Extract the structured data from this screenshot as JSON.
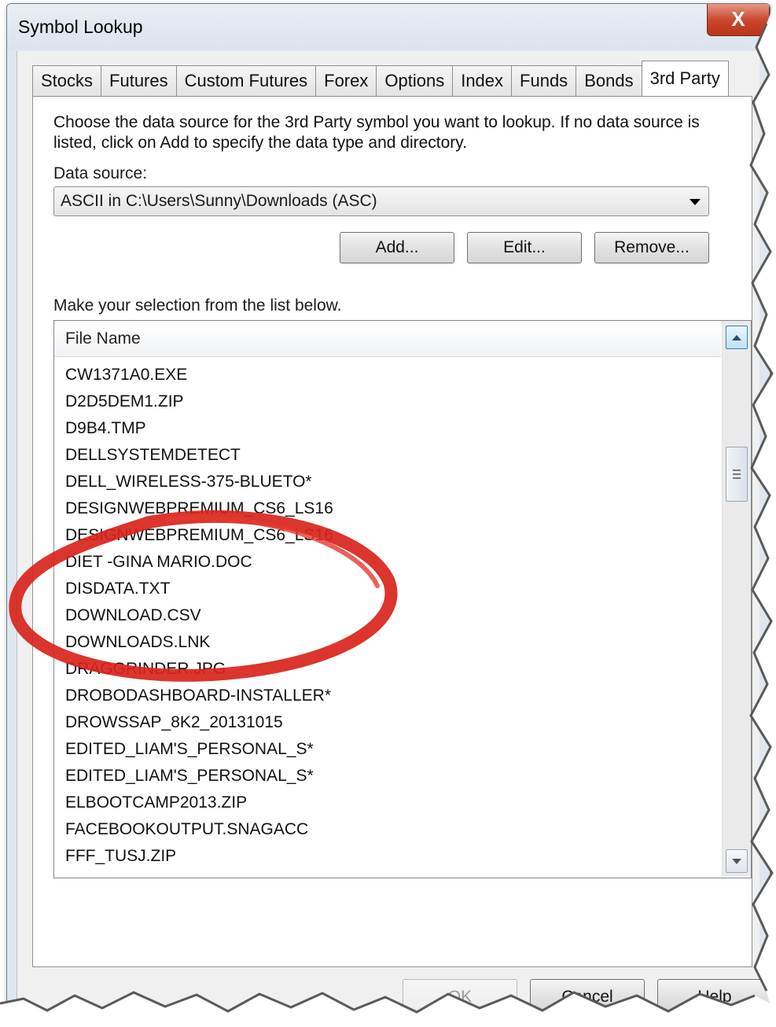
{
  "window": {
    "title": "Symbol Lookup",
    "close_glyph": "X"
  },
  "tabs": [
    {
      "label": "Stocks",
      "active": false
    },
    {
      "label": "Futures",
      "active": false
    },
    {
      "label": "Custom Futures",
      "active": false
    },
    {
      "label": "Forex",
      "active": false
    },
    {
      "label": "Options",
      "active": false
    },
    {
      "label": "Index",
      "active": false
    },
    {
      "label": "Funds",
      "active": false
    },
    {
      "label": "Bonds",
      "active": false
    },
    {
      "label": "3rd Party",
      "active": true
    }
  ],
  "panel": {
    "description": "Choose the data source for the 3rd Party symbol you want to lookup.  If no data source is listed, click on Add to specify the data type and directory.",
    "data_source_label": "Data source:",
    "data_source_value": "ASCII in C:\\Users\\Sunny\\Downloads (ASC)",
    "add_label": "Add...",
    "edit_label": "Edit...",
    "remove_label": "Remove...",
    "selection_label": "Make your selection from the list below."
  },
  "list": {
    "column_header": "File Name",
    "rows": [
      "CW1371A0.EXE",
      "D2D5DEM1.ZIP",
      "D9B4.TMP",
      "DELLSYSTEMDETECT",
      "DELL_WIRELESS-375-BLUETO*",
      "DESIGNWEBPREMIUM_CS6_LS16",
      "DESIGNWEBPREMIUM_CS6_LS16",
      "DIET -GINA MARIO.DOC",
      "DISDATA.TXT",
      "DOWNLOAD.CSV",
      "DOWNLOADS.LNK",
      "DRAGGRINDER.JPG",
      "DROBODASHBOARD-INSTALLER*",
      "DROWSSAP_8K2_20131015",
      "EDITED_LIAM'S_PERSONAL_S*",
      "EDITED_LIAM'S_PERSONAL_S*",
      "ELBOOTCAMP2013.ZIP",
      "FACEBOOKOUTPUT.SNAGACC",
      "FFF_TUSJ.ZIP"
    ]
  },
  "footer": {
    "ok_label": "OK",
    "cancel_label": "Cancel",
    "help_label": "Help"
  },
  "colors": {
    "annotation_circle": "#d8241c",
    "close_button": "#c9462c"
  },
  "icons": {
    "close": "close-icon",
    "dropdown": "chevron-down-icon",
    "scroll_up": "scroll-up-arrow-icon",
    "scroll_down": "scroll-down-arrow-icon",
    "scroll_grip": "scroll-grip-icon"
  }
}
